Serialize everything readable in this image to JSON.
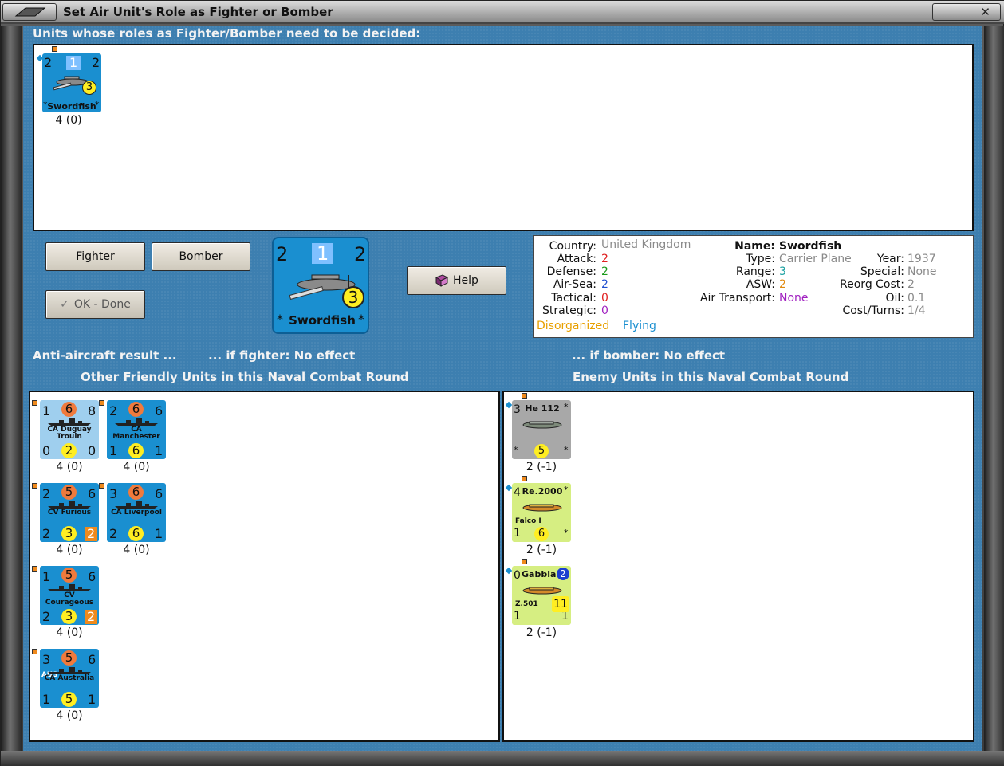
{
  "window": {
    "title": "Set Air Unit's Role as Fighter or Bomber",
    "close_glyph": "✕"
  },
  "headings": {
    "undecided": "Units whose roles as Fighter/Bomber need to be decided:",
    "aa_result": "Anti-aircraft result ...",
    "if_fighter": "... if fighter:  No effect",
    "if_bomber": "... if bomber:  No effect",
    "friendly": "Other Friendly Units in this Naval Combat Round",
    "enemy": "Enemy Units in this Naval Combat Round"
  },
  "buttons": {
    "fighter": "Fighter",
    "bomber": "Bomber",
    "ok": "OK - Done",
    "help": "Help"
  },
  "undecided_units": [
    {
      "name": "Swordfish",
      "top_left": "2",
      "top_mid": "1",
      "top_right": "2",
      "disc": "3",
      "strength": "4 (0)"
    }
  ],
  "selected_unit": {
    "name": "Swordfish",
    "top_left": "2",
    "top_mid": "1",
    "top_right": "2",
    "disc": "3"
  },
  "info": {
    "country_label": "Country:",
    "country": "United Kingdom",
    "attack_label": "Attack:",
    "attack": "2",
    "defense_label": "Defense:",
    "defense": "2",
    "airsea_label": "Air-Sea:",
    "airsea": "2",
    "tactical_label": "Tactical:",
    "tactical": "0",
    "strategic_label": "Strategic:",
    "strategic": "0",
    "status1": "Disorganized",
    "status2": "Flying",
    "name_label": "Name:",
    "name": "Swordfish",
    "type_label": "Type:",
    "type": "Carrier Plane",
    "range_label": "Range:",
    "range": "3",
    "asw_label": "ASW:",
    "asw": "2",
    "air_transport_label": "Air Transport:",
    "air_transport": "None",
    "year_label": "Year:",
    "year": "1937",
    "special_label": "Special:",
    "special": "None",
    "reorg_label": "Reorg Cost:",
    "reorg": "2",
    "oil_label": "Oil:",
    "oil": "0.1",
    "cost_label": "Cost/Turns:",
    "cost": "1/4"
  },
  "friendly_units": [
    {
      "name": "CA Duguay Trouin",
      "tl": "1",
      "tm": "6",
      "tr": "8",
      "bl": "0",
      "bm": "2",
      "br": "0",
      "strength": "4 (0)",
      "color": "lightblue"
    },
    {
      "name": "CA Manchester",
      "tl": "2",
      "tm": "6",
      "tr": "6",
      "bl": "1",
      "bm": "6",
      "br": "1",
      "strength": "4 (0)",
      "color": "blue"
    },
    {
      "name": "CV Furious",
      "tl": "2",
      "tm": "5",
      "tr": "6",
      "bl": "2",
      "bm": "3",
      "br": "2",
      "strength": "4 (0)",
      "color": "blue"
    },
    {
      "name": "CA Liverpool",
      "tl": "3",
      "tm": "6",
      "tr": "6",
      "bl": "2",
      "bm": "6",
      "br": "1",
      "strength": "4 (0)",
      "color": "blue"
    },
    {
      "name": "CV Courageous",
      "tl": "1",
      "tm": "5",
      "tr": "6",
      "bl": "2",
      "bm": "3",
      "br": "2",
      "strength": "4 (0)",
      "color": "blue"
    },
    {
      "name": "CA Australia",
      "tl": "3",
      "tm": "5",
      "tr": "6",
      "bl": "1",
      "bm": "5",
      "br": "1",
      "strength": "4 (0)",
      "color": "blue",
      "flag": "AUS"
    }
  ],
  "enemy_units": [
    {
      "name": "He 112",
      "tl": "3",
      "disc": "5",
      "strength": "2 (-1)",
      "color": "grey"
    },
    {
      "name": "Re.2000",
      "subname": "Falco I",
      "tl": "4",
      "bl": "1",
      "disc": "6",
      "strength": "2 (-1)",
      "color": "lime"
    },
    {
      "name": "Gabbiano",
      "subname": "Z.501",
      "tl": "0",
      "tr": "2",
      "bl": "1",
      "br": "1",
      "disc": "11",
      "strength": "2 (-1)",
      "color": "lime"
    }
  ],
  "colors": {
    "background": "#3d7fb0",
    "counter_blue": "#1a8fd0",
    "attack_disc": "#f07a3c",
    "defense_disc": "#ffee22",
    "value_red": "#e02020",
    "value_green": "#1a9a1a",
    "value_blue": "#2050d0",
    "value_grey": "#8a8a8a",
    "value_orange": "#e08a10",
    "value_purple": "#a020c0",
    "status_orange": "#e8a000",
    "status_blue": "#1a8fd0"
  }
}
